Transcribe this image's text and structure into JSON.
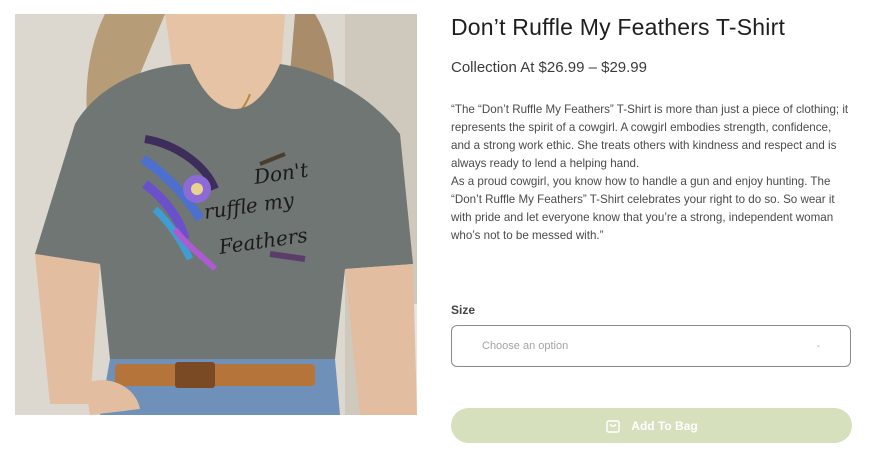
{
  "product": {
    "title": "Don’t Ruffle My Feathers T-Shirt",
    "price": "Collection At $26.99 – $29.99",
    "description": [
      "“The “Don’t Ruffle My Feathers” T-Shirt is more than just a piece of clothing; it represents the spirit of a cowgirl. A cowgirl embodies strength, confidence, and a strong work ethic. She treats others with kindness and respect and is always ready to lend a helping hand.",
      "As a proud cowgirl, you know how to handle a gun and enjoy hunting. The “Don’t Ruffle My Feathers” T-Shirt celebrates your right to do so. So wear it with pride and let everyone know that you’re a strong, independent woman who’s not to be messed with.”"
    ],
    "image_print_text": [
      "Don't",
      "ruffle my",
      "Feathers"
    ]
  },
  "size": {
    "label": "Size",
    "placeholder": "Choose an option",
    "caret": "-"
  },
  "cart": {
    "button_label": "Add To Bag",
    "icon": "shopping-bag-icon"
  },
  "colors": {
    "button_bg": "#d6e0bd",
    "shirt": "#6f7673",
    "text_dark": "#1e1e1e"
  }
}
